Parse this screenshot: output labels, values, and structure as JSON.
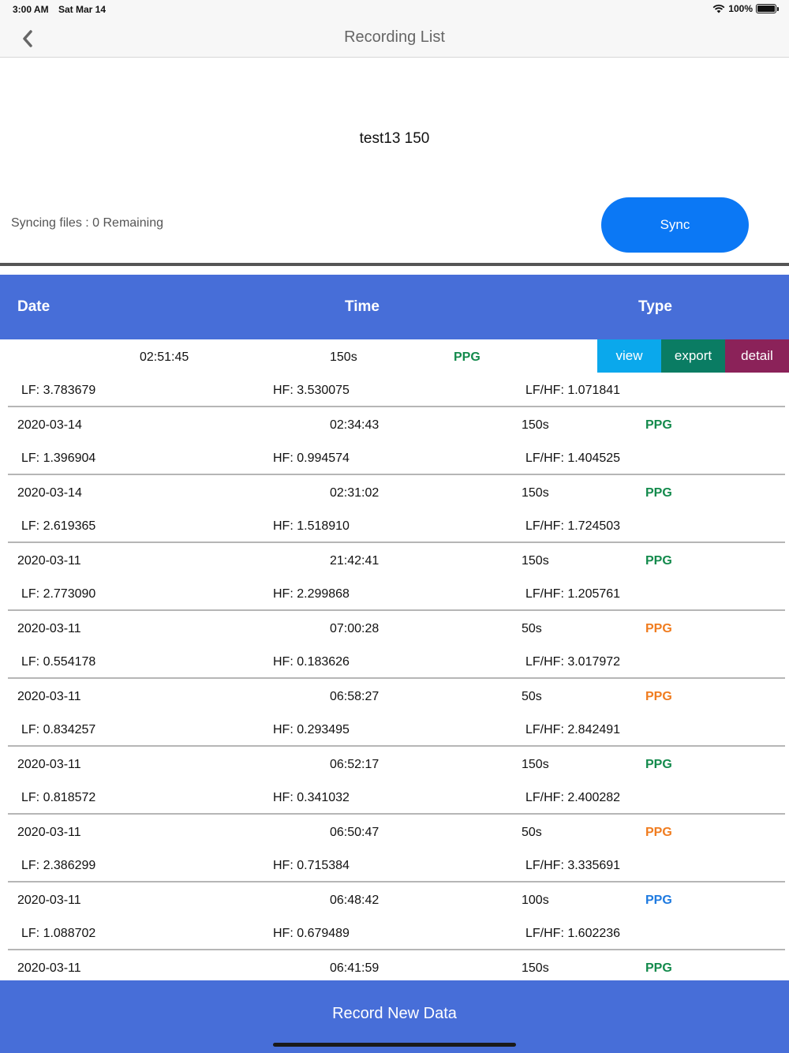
{
  "status": {
    "time": "3:00 AM",
    "date": "Sat Mar 14",
    "battery": "100%",
    "battery_level": 1.0
  },
  "nav": {
    "title": "Recording List"
  },
  "device": {
    "name": "test13 150"
  },
  "sync": {
    "status": "Syncing files : 0 Remaining",
    "button_label": "Sync"
  },
  "table": {
    "headers": {
      "date": "Date",
      "time": "Time",
      "type": "Type"
    },
    "actions": {
      "view": "view",
      "export": "export",
      "detail": "detail"
    },
    "rows": [
      {
        "date": "",
        "time": "02:51:45",
        "duration": "150s",
        "type": "PPG",
        "lf": "LF: 3.783679",
        "hf": "HF: 3.530075",
        "ratio": "LF/HF: 1.071841"
      },
      {
        "date": "2020-03-14",
        "time": "02:34:43",
        "duration": "150s",
        "type": "PPG",
        "lf": "LF: 1.396904",
        "hf": "HF: 0.994574",
        "ratio": "LF/HF: 1.404525"
      },
      {
        "date": "2020-03-14",
        "time": "02:31:02",
        "duration": "150s",
        "type": "PPG",
        "lf": "LF: 2.619365",
        "hf": "HF: 1.518910",
        "ratio": "LF/HF: 1.724503"
      },
      {
        "date": "2020-03-11",
        "time": "21:42:41",
        "duration": "150s",
        "type": "PPG",
        "lf": "LF: 2.773090",
        "hf": "HF: 2.299868",
        "ratio": "LF/HF: 1.205761"
      },
      {
        "date": "2020-03-11",
        "time": "07:00:28",
        "duration": "50s",
        "type": "PPG",
        "lf": "LF: 0.554178",
        "hf": "HF: 0.183626",
        "ratio": "LF/HF: 3.017972"
      },
      {
        "date": "2020-03-11",
        "time": "06:58:27",
        "duration": "50s",
        "type": "PPG",
        "lf": "LF: 0.834257",
        "hf": "HF: 0.293495",
        "ratio": "LF/HF: 2.842491"
      },
      {
        "date": "2020-03-11",
        "time": "06:52:17",
        "duration": "150s",
        "type": "PPG",
        "lf": "LF: 0.818572",
        "hf": "HF: 0.341032",
        "ratio": "LF/HF: 2.400282"
      },
      {
        "date": "2020-03-11",
        "time": "06:50:47",
        "duration": "50s",
        "type": "PPG",
        "lf": "LF: 2.386299",
        "hf": "HF: 0.715384",
        "ratio": "LF/HF: 3.335691"
      },
      {
        "date": "2020-03-11",
        "time": "06:48:42",
        "duration": "100s",
        "type": "PPG",
        "lf": "LF: 1.088702",
        "hf": "HF: 0.679489",
        "ratio": "LF/HF: 1.602236"
      },
      {
        "date": "2020-03-11",
        "time": "06:41:59",
        "duration": "150s",
        "type": "PPG",
        "lf": "",
        "hf": "",
        "ratio": ""
      }
    ]
  },
  "colors": {
    "type_150s": "#138a4c",
    "type_100s": "#1e7ae0",
    "type_50s": "#f07c1f",
    "header_bg": "#476ed8",
    "sync_button": "#0b78f5"
  },
  "footer": {
    "button_label": "Record New Data"
  }
}
